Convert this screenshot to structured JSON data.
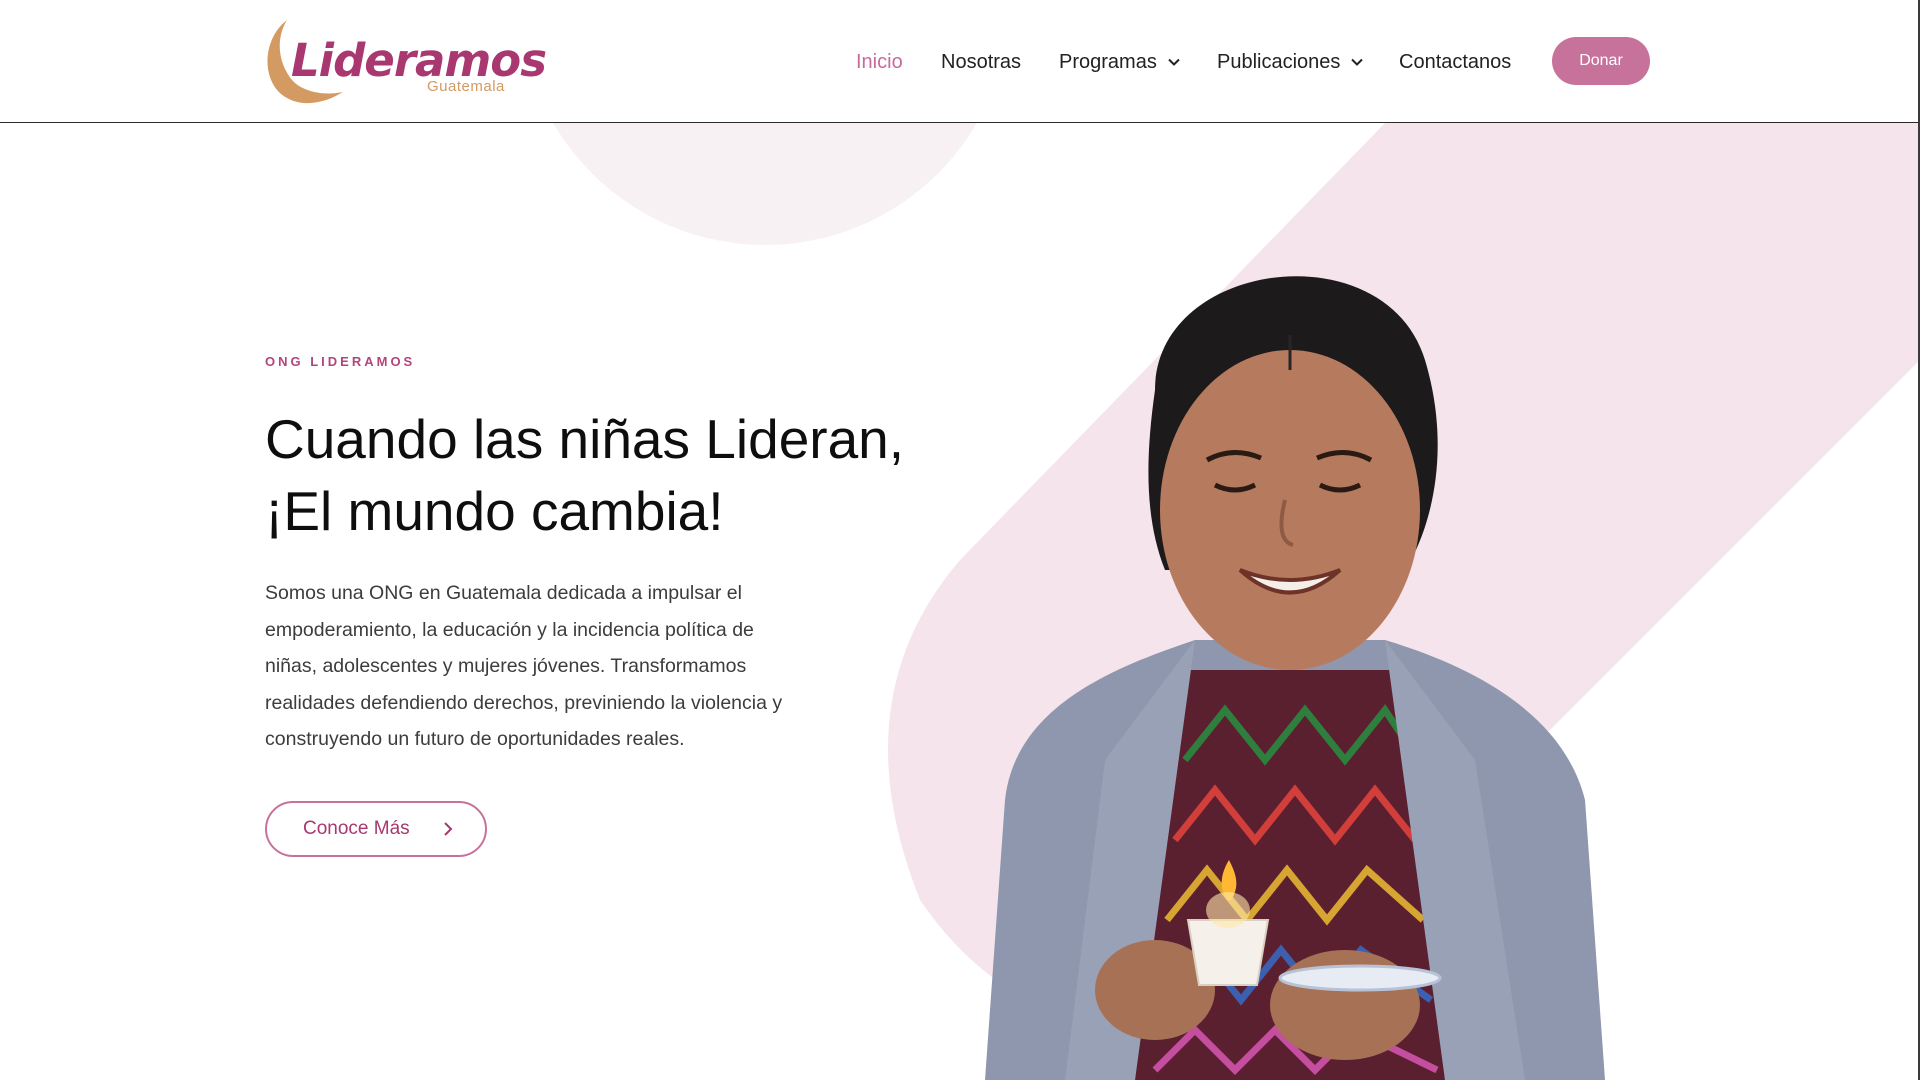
{
  "brand": {
    "name": "Lideramos",
    "tagline": "Guatemala",
    "colors": {
      "primary": "#a8386f",
      "accent": "#c7729b",
      "gold": "#d39a61",
      "soft_pink": "#f6e4ec"
    }
  },
  "nav": {
    "items": [
      {
        "label": "Inicio",
        "active": true,
        "has_dropdown": false
      },
      {
        "label": "Nosotras",
        "active": false,
        "has_dropdown": false
      },
      {
        "label": "Programas",
        "active": false,
        "has_dropdown": true
      },
      {
        "label": "Publicaciones",
        "active": false,
        "has_dropdown": true
      },
      {
        "label": "Contactanos",
        "active": false,
        "has_dropdown": false
      }
    ],
    "donate_label": "Donar"
  },
  "hero": {
    "eyebrow": "ONG LIDERAMOS",
    "headline_line1": "Cuando las niñas Lideran,",
    "headline_line2": "¡El mundo cambia!",
    "intro": "Somos una ONG en Guatemala dedicada a impulsar el empoderamiento, la educación y la incidencia política de niñas, adolescentes y mujeres jóvenes. Transformamos realidades defendiendo derechos, previniendo la violencia y construyendo un futuro de oportunidades reales.",
    "cta_label": "Conoce Más",
    "cta_icon": "chevron-right-icon",
    "image_subject": "girl-with-candle"
  }
}
